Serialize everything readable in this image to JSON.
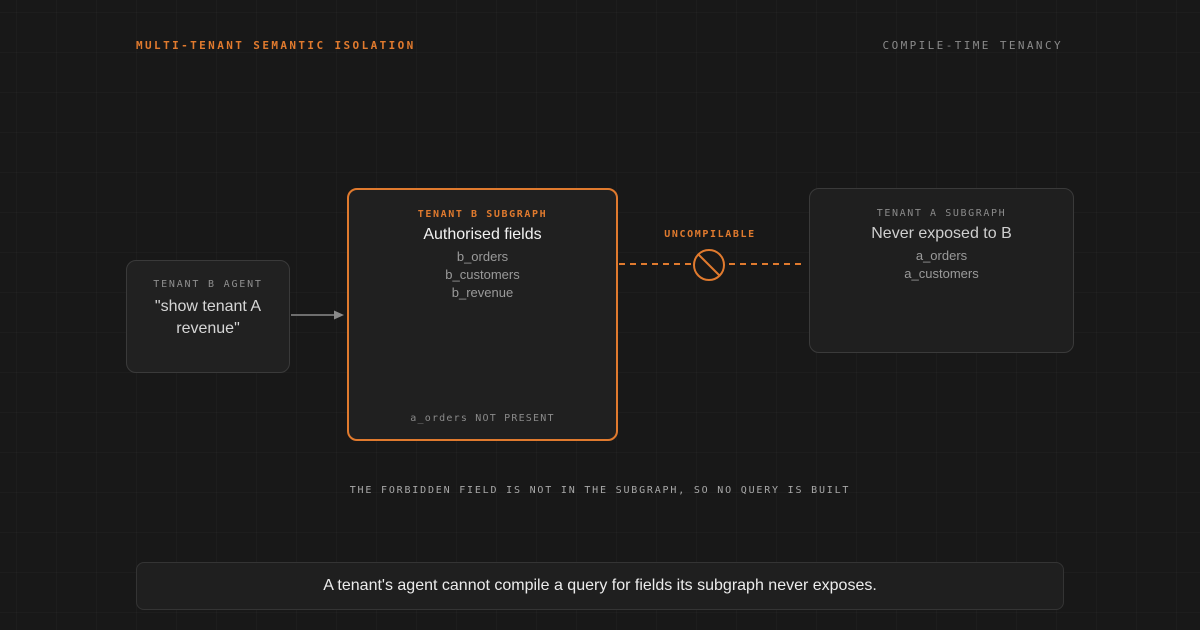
{
  "header": {
    "title": "MULTI-TENANT SEMANTIC ISOLATION",
    "tag": "COMPILE-TIME TENANCY"
  },
  "agent": {
    "label": "TENANT B AGENT",
    "query": "\"show tenant A revenue\""
  },
  "tenant_b": {
    "label": "TENANT B SUBGRAPH",
    "title": "Authorised fields",
    "fields": [
      "b_orders",
      "b_customers",
      "b_revenue"
    ],
    "absent_note": "a_orders NOT PRESENT"
  },
  "tenant_a": {
    "label": "TENANT A SUBGRAPH",
    "title": "Never exposed to B",
    "fields": [
      "a_orders",
      "a_customers"
    ]
  },
  "link": {
    "label": "UNCOMPILABLE",
    "icon": "prohibited-icon"
  },
  "caption": "THE FORBIDDEN FIELD IS NOT IN THE SUBGRAPH, SO NO QUERY IS BUILT",
  "footer": "A tenant's agent cannot compile a query for fields its subgraph never exposes.",
  "colors": {
    "accent": "#e07a2e",
    "background": "#181818",
    "box": "#212121",
    "border": "#3a3a3a"
  }
}
